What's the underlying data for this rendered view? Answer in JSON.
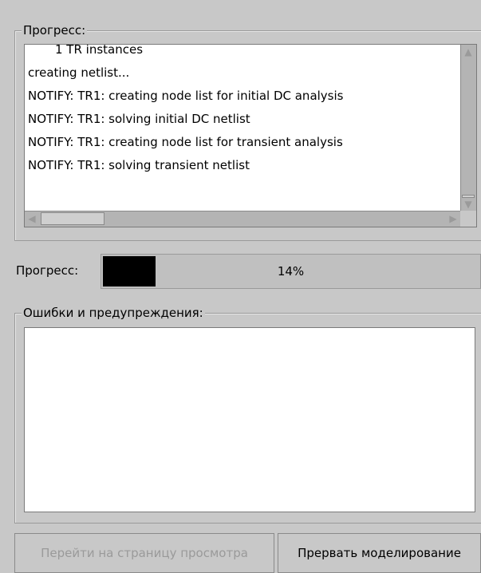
{
  "log_group": {
    "title": "Прогресс:",
    "lines": [
      "1 TR instances",
      "creating netlist...",
      "NOTIFY: TR1: creating node list for initial DC analysis",
      "NOTIFY: TR1: solving initial DC netlist",
      "NOTIFY: TR1: creating node list for transient analysis",
      "NOTIFY: TR1: solving transient netlist"
    ]
  },
  "progress": {
    "label": "Прогресс:",
    "percent_text": "14%",
    "value": 0.14
  },
  "errors_group": {
    "title": "Ошибки и предупреждения:"
  },
  "buttons": {
    "view_page": "Перейти на страницу просмотра",
    "abort": "Прервать моделирование"
  },
  "icons": {
    "up": "▲",
    "down": "▼",
    "left": "◀",
    "right": "▶"
  }
}
